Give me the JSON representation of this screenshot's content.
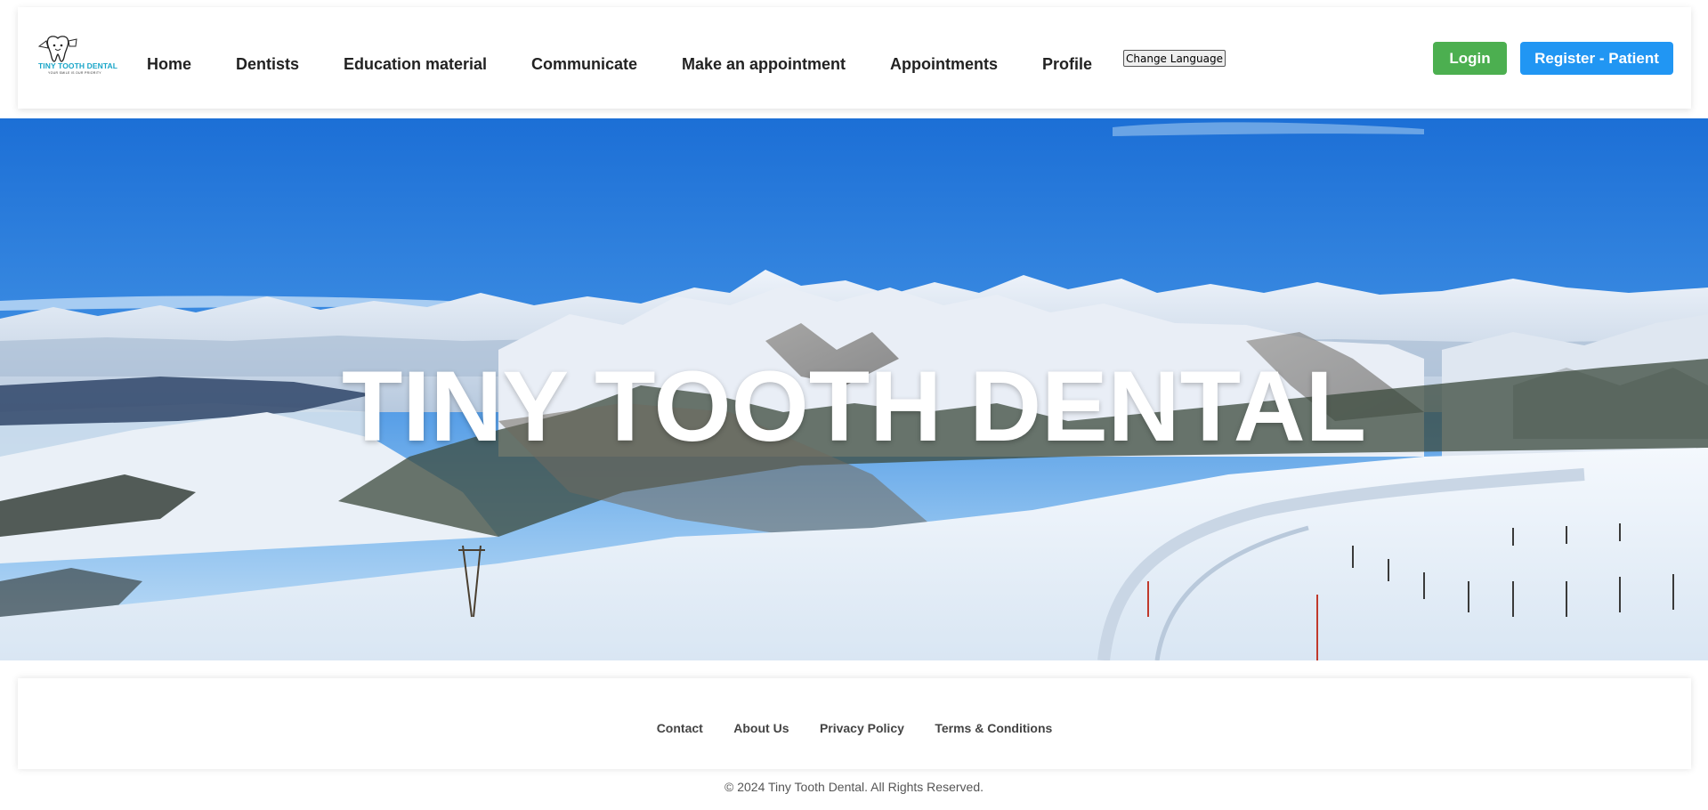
{
  "brand": {
    "logo_text": "TINY TOOTH DENTAL",
    "logo_tagline": "YOUR SMILE IS OUR PRIORITY",
    "logo_icon": "tooth-icon",
    "accent_color": "#18a5c8"
  },
  "nav": {
    "items": [
      {
        "label": "Home"
      },
      {
        "label": "Dentists"
      },
      {
        "label": "Education material"
      },
      {
        "label": "Communicate"
      },
      {
        "label": "Make an appointment"
      },
      {
        "label": "Appointments"
      },
      {
        "label": "Profile"
      }
    ],
    "change_language": "Change Language"
  },
  "auth": {
    "login_label": "Login",
    "login_color": "#4caf50",
    "register_label": "Register - Patient",
    "register_color": "#2196f3"
  },
  "hero": {
    "title": "TINY TOOTH DENTAL"
  },
  "footer": {
    "links": [
      {
        "label": "Contact"
      },
      {
        "label": "About Us"
      },
      {
        "label": "Privacy Policy"
      },
      {
        "label": "Terms & Conditions"
      }
    ],
    "copyright": "© 2024 Tiny Tooth Dental. All Rights Reserved."
  }
}
